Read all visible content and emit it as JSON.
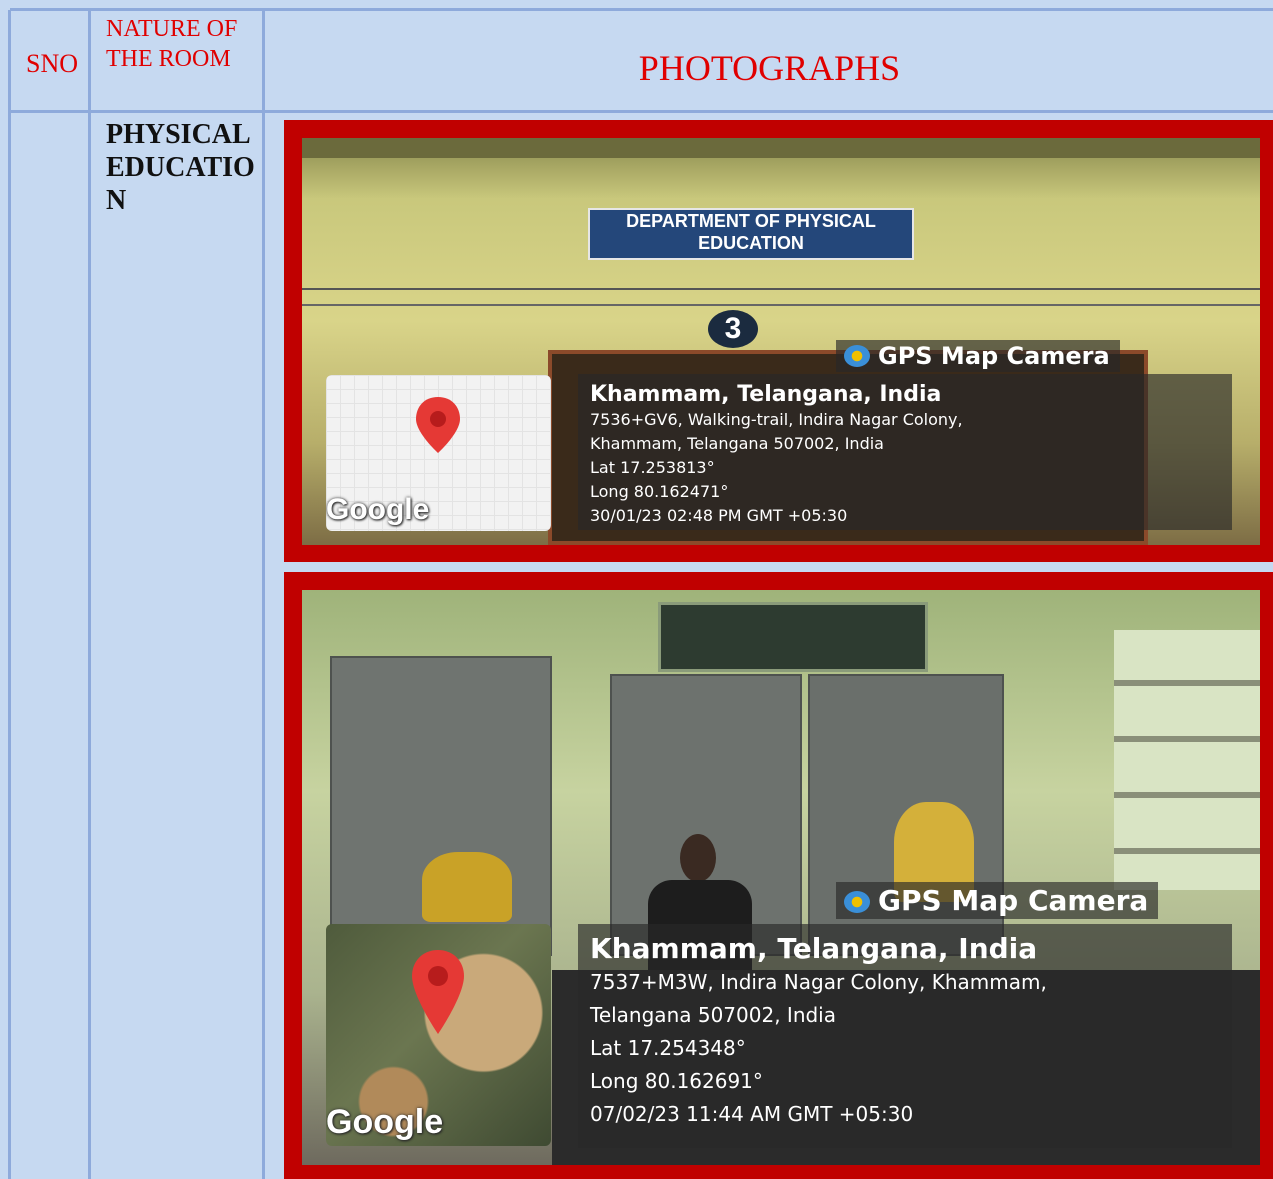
{
  "header": {
    "sno": "SNO",
    "nature": "NATURE OF THE ROOM",
    "photographs": "PHOTOGRAPHS"
  },
  "row": {
    "room_name": "PHYSICAL EDUCATION"
  },
  "photos": [
    {
      "sign": "DEPARTMENT OF PHYSICAL EDUCATION",
      "room_number": "3",
      "app": "GPS Map Camera",
      "city": "Khammam, Telangana, India",
      "address_line1": "7536+GV6, Walking-trail, Indira Nagar Colony,",
      "address_line2": "Khammam, Telangana 507002, India",
      "lat": "Lat 17.253813°",
      "long": "Long 80.162471°",
      "datetime": "30/01/23 02:48 PM GMT +05:30",
      "map_brand": "Google"
    },
    {
      "app": "GPS Map Camera",
      "city": "Khammam, Telangana, India",
      "address_line1": "7537+M3W, Indira Nagar Colony, Khammam,",
      "address_line2": "Telangana 507002, India",
      "lat": "Lat 17.254348°",
      "long": "Long 80.162691°",
      "datetime": "07/02/23 11:44 AM GMT +05:30",
      "map_brand": "Google"
    }
  ],
  "colors": {
    "header_text": "#e00000",
    "cell_bg": "#c6d9f1",
    "grid": "#8eaadb",
    "frame": "#c00000"
  }
}
